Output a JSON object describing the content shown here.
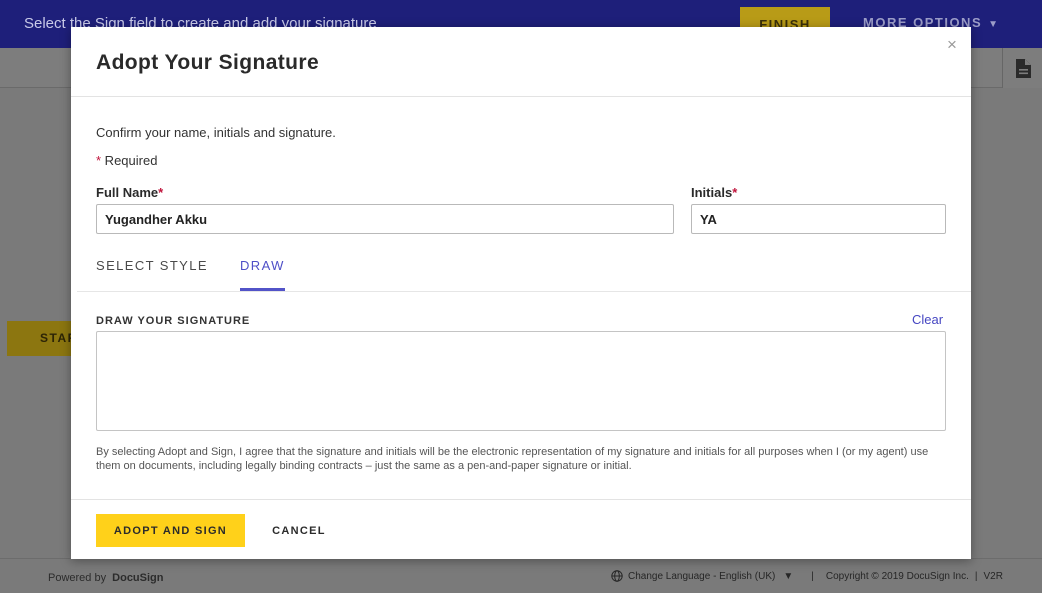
{
  "topbar": {
    "message": "Select the Sign field to create and add your signature",
    "finish_label": "FINISH",
    "more_options_label": "MORE OPTIONS",
    "more_options_icon": "caret-down-icon"
  },
  "toolbar": {
    "document_icon": "document-icon"
  },
  "page": {
    "start_label": "START"
  },
  "modal": {
    "title": "Adopt Your Signature",
    "close_label": "×",
    "confirm_text": "Confirm your name, initials and signature.",
    "required_star": "*",
    "required_text": " Required",
    "full_name": {
      "label": "Full Name",
      "star": "*",
      "value": "Yugandher Akku"
    },
    "initials": {
      "label": "Initials",
      "star": "*",
      "value": "YA"
    },
    "tabs": [
      {
        "label": "SELECT STYLE",
        "active": false
      },
      {
        "label": "DRAW",
        "active": true
      }
    ],
    "draw_label": "DRAW YOUR SIGNATURE",
    "clear_label": "Clear",
    "legal_text": "By selecting Adopt and Sign, I agree that the signature and initials will be the electronic representation of my signature and initials for all purposes when I (or my agent) use them on documents, including legally binding contracts – just the same as a pen-and-paper signature or initial.",
    "adopt_label": "ADOPT AND SIGN",
    "cancel_label": "CANCEL"
  },
  "footer": {
    "powered_by": "Powered by",
    "brand": "DocuSign",
    "change_language": "Change Language - English (UK)",
    "separator": "|",
    "copyright": "Copyright © 2019 DocuSign Inc.",
    "version": "V2R"
  },
  "colors": {
    "topbar": "#1e1f7a",
    "accent_yellow": "#ffd11a",
    "tab_active": "#4e4fc7",
    "required": "#c0143c"
  }
}
